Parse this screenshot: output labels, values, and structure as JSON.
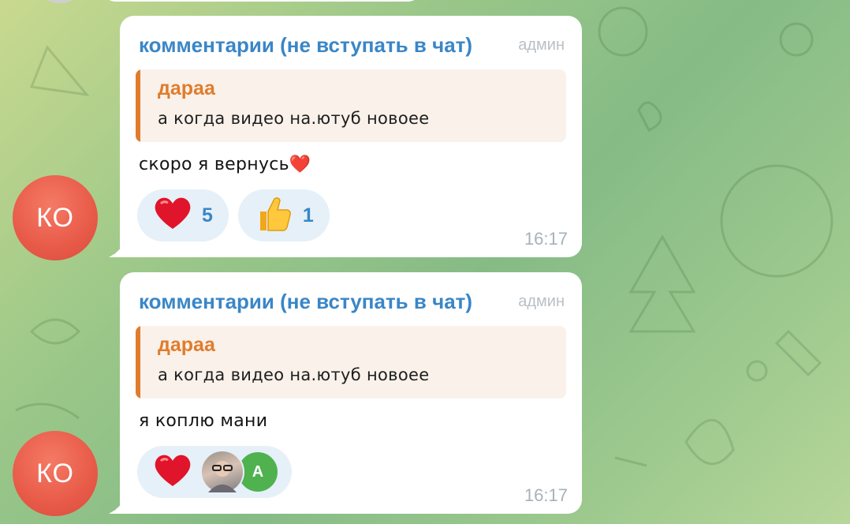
{
  "messages": [
    {
      "avatar_initials": "КО",
      "sender": "комментарии (не вступать в чат)",
      "role": "админ",
      "reply": {
        "author": "дараа",
        "text": "а когда видео на.ютуб новоее"
      },
      "text": "скоро я вернусь❤️",
      "reactions": [
        {
          "icon": "heart-icon",
          "emoji": "❤️",
          "count": "5"
        },
        {
          "icon": "thumbs-up-icon",
          "emoji": "👍",
          "count": "1"
        }
      ],
      "time": "16:17"
    },
    {
      "avatar_initials": "КО",
      "sender": "комментарии (не вступать в чат)",
      "role": "админ",
      "reply": {
        "author": "дараа",
        "text": "а когда видео на.ютуб новоее"
      },
      "text": "я коплю мани",
      "reactions": [
        {
          "icon": "heart-icon",
          "emoji": "❤️",
          "reactors": [
            "photo",
            "A"
          ]
        }
      ],
      "time": "16:17"
    }
  ],
  "colors": {
    "sender": "#3a86c7",
    "reply_accent": "#e07c2c",
    "avatar": "#e85a48",
    "reaction_bg": "#e6f0f8",
    "reactor_avatar": "#4fb24f"
  }
}
